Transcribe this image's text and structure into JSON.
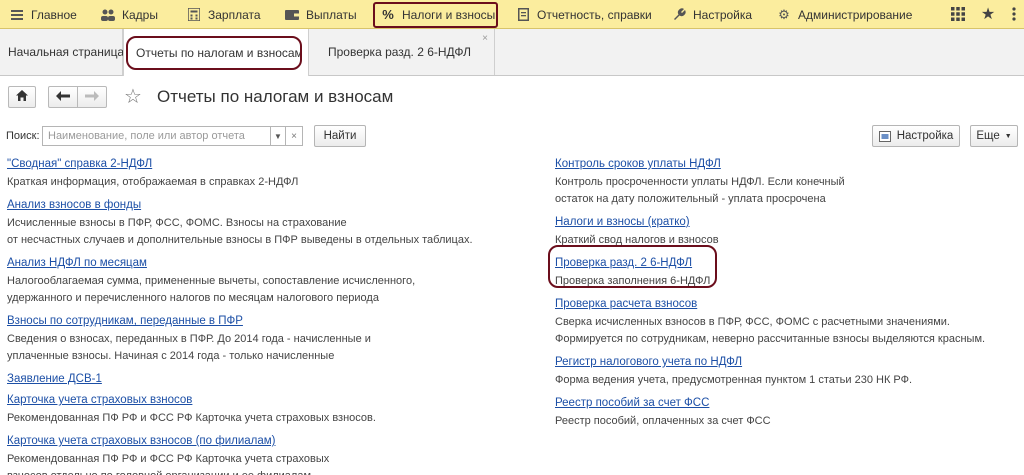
{
  "menu": [
    {
      "label": "Главное",
      "icon": "menu-lines-icon"
    },
    {
      "label": "Кадры",
      "icon": "people-icon"
    },
    {
      "label": "Зарплата",
      "icon": "calculator-icon"
    },
    {
      "label": "Выплаты",
      "icon": "wallet-icon"
    },
    {
      "label": "Налоги и взносы",
      "icon": "percent-icon",
      "active": true
    },
    {
      "label": "Отчетность, справки",
      "icon": "document-icon"
    },
    {
      "label": "Настройка",
      "icon": "wrench-icon"
    },
    {
      "label": "Администрирование",
      "icon": "gear-icon"
    }
  ],
  "tabs": [
    {
      "label": "Начальная страница"
    },
    {
      "label": "Отчеты по налогам и взносам",
      "active": true
    },
    {
      "label": "Проверка разд. 2 6-НДФЛ",
      "close": "×"
    }
  ],
  "page": {
    "title": "Отчеты по налогам и взносам",
    "search_label": "Поиск:",
    "search_placeholder": "Наименование, поле или автор отчета",
    "find_button": "Найти",
    "settings_button": "Настройка",
    "more_button": "Еще"
  },
  "reports_left": [
    {
      "title": "\"Сводная\" справка 2-НДФЛ",
      "desc": [
        "Краткая информация, отображаемая в справках 2-НДФЛ"
      ]
    },
    {
      "title": "Анализ взносов в фонды",
      "desc": [
        "Исчисленные взносы в ПФР, ФСС, ФОМС. Взносы на страхование",
        "от несчастных случаев и дополнительные взносы в ПФР выведены в отдельных таблицах."
      ]
    },
    {
      "title": "Анализ НДФЛ по месяцам",
      "desc": [
        "Налогооблагаемая сумма, примененные вычеты, сопоставление исчисленного,",
        "удержанного и перечисленного налогов по месяцам налогового периода"
      ]
    },
    {
      "title": "Взносы по сотрудникам, переданные в ПФР",
      "desc": [
        "Сведения о взносах, переданных в ПФР. До 2014 года - начисленные и",
        "уплаченные взносы. Начиная с 2014 года - только начисленные"
      ]
    },
    {
      "title": "Заявление ДСВ-1",
      "desc": []
    },
    {
      "title": "Карточка учета страховых взносов",
      "desc": [
        "Рекомендованная ПФ РФ и ФСС РФ Карточка учета страховых взносов."
      ]
    },
    {
      "title": "Карточка учета страховых взносов (по филиалам)",
      "desc": [
        "Рекомендованная ПФ РФ и ФСС РФ Карточка учета страховых",
        "взносов отдельно по головной организации и ее филиалам."
      ]
    }
  ],
  "reports_right": [
    {
      "title": "Контроль сроков уплаты НДФЛ",
      "desc": [
        "Контроль просроченности уплаты НДФЛ. Если конечный",
        "остаток на дату положительный - уплата просрочена"
      ]
    },
    {
      "title": "Налоги и взносы (кратко)",
      "desc": [
        "Краткий свод налогов и взносов"
      ]
    },
    {
      "title": "Проверка разд. 2 6-НДФЛ",
      "desc": [
        "Проверка заполнения 6-НДФЛ"
      ]
    },
    {
      "title": "Проверка расчета взносов",
      "desc": [
        "Сверка исчисленных взносов в ПФР, ФСС, ФОМС с расчетными значениями.",
        "Формируется по сотрудникам, неверно рассчитанные взносы выделяются красным."
      ]
    },
    {
      "title": "Регистр налогового учета по НДФЛ",
      "desc": [
        "Форма ведения учета, предусмотренная пунктом 1 статьи 230 НК РФ."
      ]
    },
    {
      "title": "Реестр пособий за счет ФСС",
      "desc": [
        "Реестр пособий, оплаченных за счет ФСС"
      ]
    }
  ],
  "colors": {
    "menu_bg": "#fbed9e",
    "link": "#1c4fa6",
    "highlight": "#6b0e1c"
  }
}
